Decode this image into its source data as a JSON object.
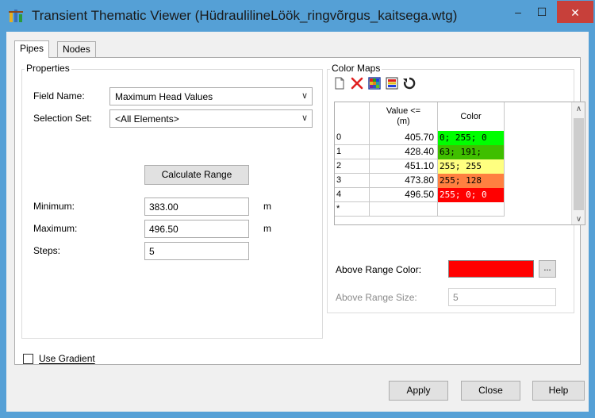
{
  "window": {
    "title": "Transient Thematic Viewer (HüdraulilineLöök_ringvõrgus_kaitsega.wtg)",
    "min_glyph": "‒",
    "max_glyph": "☐",
    "close_glyph": "✕"
  },
  "tabs": [
    {
      "label": "Pipes",
      "active": true
    },
    {
      "label": "Nodes",
      "active": false
    }
  ],
  "properties": {
    "group_label": "Properties",
    "field_name_label": "Field Name:",
    "field_name_value": "Maximum Head Values",
    "selection_set_label": "Selection Set:",
    "selection_set_value": "<All Elements>",
    "calculate_label": "Calculate Range",
    "minimum_label": "Minimum:",
    "minimum_value": "383.00",
    "minimum_unit": "m",
    "maximum_label": "Maximum:",
    "maximum_value": "496.50",
    "maximum_unit": "m",
    "steps_label": "Steps:",
    "steps_value": "5"
  },
  "color_maps": {
    "group_label": "Color Maps",
    "columns": {
      "value": "Value <=\n(m)",
      "color": "Color"
    },
    "rows": [
      {
        "index": "0",
        "value": "405.70",
        "color_text": "0; 255; 0",
        "color": "#00ff00"
      },
      {
        "index": "1",
        "value": "428.40",
        "color_text": "63; 191;",
        "color": "#3fbf00"
      },
      {
        "index": "2",
        "value": "451.10",
        "color_text": "255; 255",
        "color": "#ffff80"
      },
      {
        "index": "3",
        "value": "473.80",
        "color_text": "255; 128",
        "color": "#ff8040"
      },
      {
        "index": "4",
        "value": "496.50",
        "color_text": "255; 0; 0",
        "color": "#ff0000"
      }
    ],
    "new_row_marker": "*",
    "above_range_color_label": "Above Range Color:",
    "above_range_color": "#ff0000",
    "ellipsis_label": "...",
    "above_range_size_label": "Above Range Size:",
    "above_range_size_value": "5"
  },
  "use_gradient_label": "Use Gradient",
  "footer": {
    "apply_label": "Apply",
    "close_label": "Close",
    "help_label": "Help"
  },
  "accent_color": "#55a0d6"
}
